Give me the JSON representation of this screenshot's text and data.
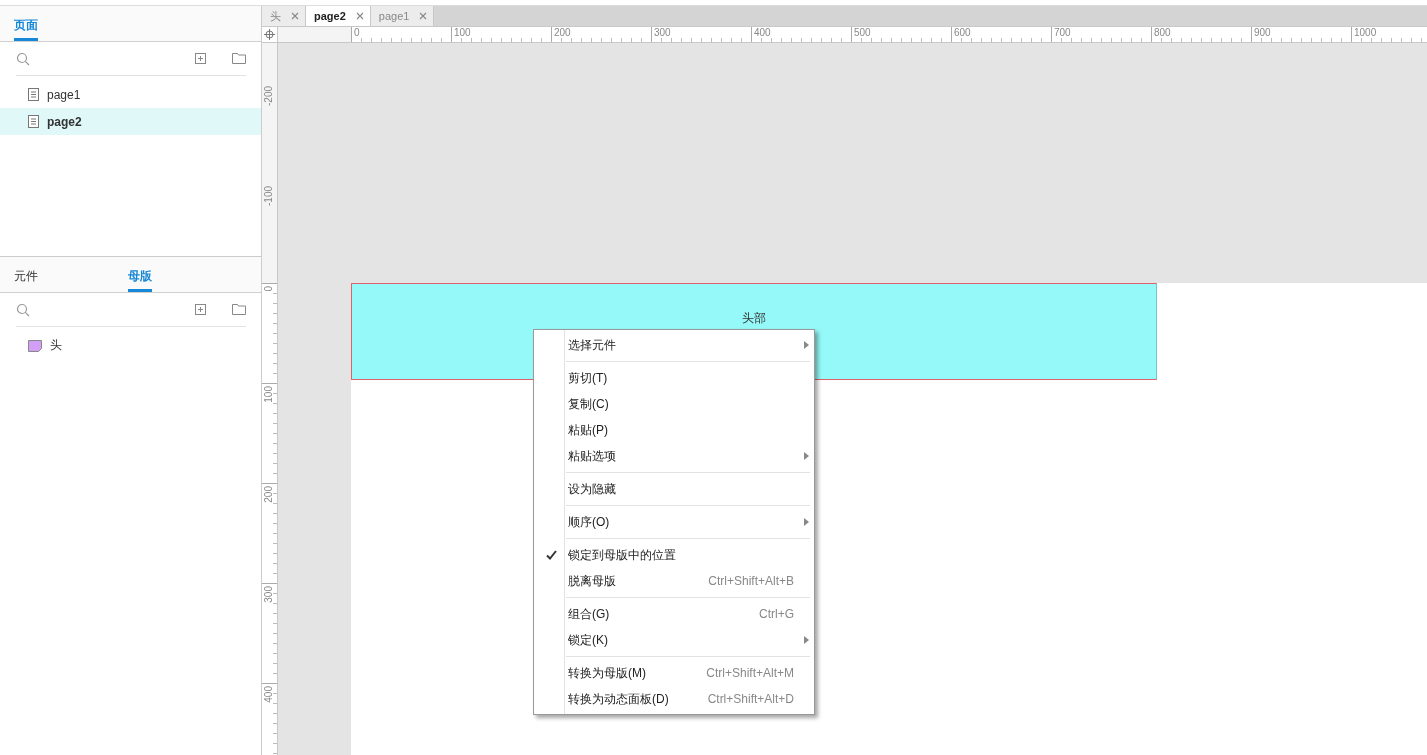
{
  "pages_panel": {
    "tabs": [
      {
        "label": "页面",
        "selected": true
      }
    ],
    "items": [
      {
        "label": "page1",
        "selected": false
      },
      {
        "label": "page2",
        "selected": true
      }
    ]
  },
  "masters_panel": {
    "tabs": [
      {
        "label": "元件",
        "selected": false
      },
      {
        "label": "母版",
        "selected": true
      }
    ],
    "items": [
      {
        "label": "头"
      }
    ]
  },
  "document_tabs": [
    {
      "label": "头",
      "selected": false
    },
    {
      "label": "page2",
      "selected": true
    },
    {
      "label": "page1",
      "selected": false
    }
  ],
  "rulers": {
    "horizontal": [
      "0",
      "100",
      "200",
      "300",
      "400",
      "500",
      "600",
      "700",
      "800",
      "900",
      "1000"
    ],
    "vertical": [
      "-200",
      "-100",
      "0",
      "100",
      "200",
      "300",
      "400"
    ]
  },
  "canvas": {
    "shapes": [
      {
        "label": "头部"
      }
    ]
  },
  "context_menu": {
    "items": [
      {
        "kind": "item",
        "label": "选择元件",
        "checked": false,
        "submenu": true
      },
      {
        "kind": "separator"
      },
      {
        "kind": "item",
        "label": "剪切(T)",
        "checked": false,
        "submenu": false
      },
      {
        "kind": "item",
        "label": "复制(C)",
        "checked": false,
        "submenu": false
      },
      {
        "kind": "item",
        "label": "粘贴(P)",
        "checked": false,
        "submenu": false
      },
      {
        "kind": "item",
        "label": "粘贴选项",
        "checked": false,
        "submenu": true
      },
      {
        "kind": "separator"
      },
      {
        "kind": "item",
        "label": "设为隐藏",
        "checked": false,
        "submenu": false
      },
      {
        "kind": "separator"
      },
      {
        "kind": "item",
        "label": "顺序(O)",
        "checked": false,
        "submenu": true
      },
      {
        "kind": "separator"
      },
      {
        "kind": "item",
        "label": "锁定到母版中的位置",
        "checked": true,
        "submenu": false
      },
      {
        "kind": "item",
        "label": "脱离母版",
        "checked": false,
        "submenu": false,
        "shortcut": "Ctrl+Shift+Alt+B"
      },
      {
        "kind": "separator"
      },
      {
        "kind": "item",
        "label": "组合(G)",
        "checked": false,
        "submenu": false,
        "shortcut": "Ctrl+G"
      },
      {
        "kind": "item",
        "label": "锁定(K)",
        "checked": false,
        "submenu": true
      },
      {
        "kind": "separator"
      },
      {
        "kind": "item",
        "label": "转换为母版(M)",
        "checked": false,
        "submenu": false,
        "shortcut": "Ctrl+Shift+Alt+M"
      },
      {
        "kind": "item",
        "label": "转换为动态面板(D)",
        "checked": false,
        "submenu": false,
        "shortcut": "Ctrl+Shift+Alt+D"
      }
    ]
  }
}
